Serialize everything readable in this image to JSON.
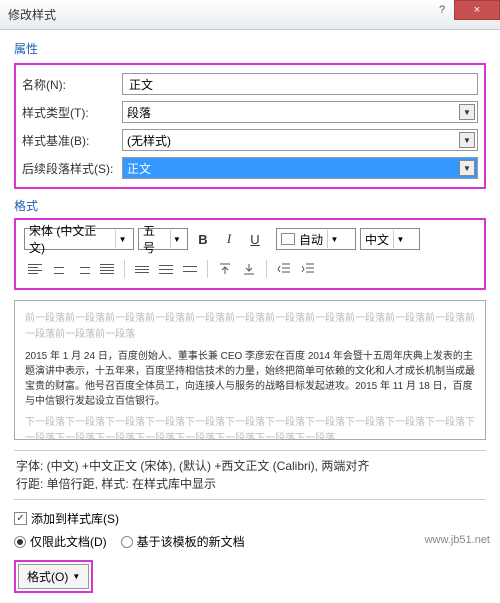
{
  "window": {
    "title": "修改样式",
    "help": "?",
    "close": "×"
  },
  "section": {
    "props": "属性",
    "format": "格式"
  },
  "labels": {
    "name": "名称(N):",
    "type": "样式类型(T):",
    "base": "样式基准(B):",
    "next": "后续段落样式(S):"
  },
  "values": {
    "name": "正文",
    "type": "段落",
    "base": "(无样式)",
    "next": "正文"
  },
  "toolbar": {
    "font": "宋体 (中文正文)",
    "size": "五号",
    "b": "B",
    "i": "I",
    "u": "U",
    "auto": "自动",
    "lang": "中文"
  },
  "preview": {
    "gray_top": "前一段落前一段落前一段落前一段落前一段落前一段落前一段落前一段落前一段落前一段落前一段落前一段落前一段落前一段落",
    "body": "2015 年 1 月 24 日，百度创始人、董事长兼 CEO 李彦宏在百度 2014 年会暨十五周年庆典上发表的主题演讲中表示，十五年来，百度坚持相信技术的力量，始终把简单可依赖的文化和人才成长机制当成最宝贵的财富。他号召百度全体员工，向连接人与服务的战略目标发起进攻。2015 年 11 月 18 日，百度与中信银行发起设立百信银行。",
    "gray_bot": "下一段落下一段落下一段落下一段落下一段落下一段落下一段落下一段落下一段落下一段落下一段落下一段落下一段落下一段落下一段落下一段落下一段落下一段落下一段落"
  },
  "desc": {
    "line1": "字体: (中文) +中文正文 (宋体), (默认) +西文正文 (Calibri), 两端对齐",
    "line2": "行距: 单倍行距, 样式: 在样式库中显示"
  },
  "opts": {
    "addToGallery": "添加到样式库(S)",
    "thisDoc": "仅限此文档(D)",
    "template": "基于该模板的新文档"
  },
  "footer": {
    "format": "格式(O)"
  },
  "watermark": "www.jb51.net"
}
